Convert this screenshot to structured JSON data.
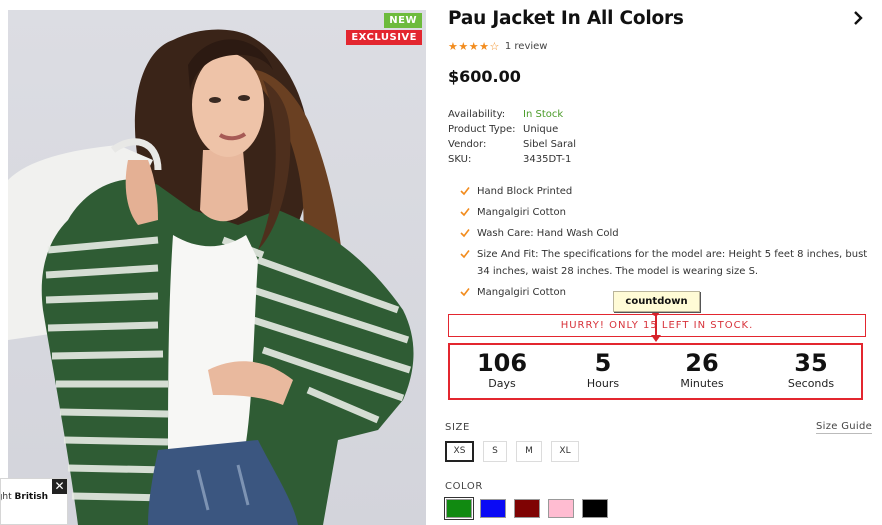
{
  "badges": {
    "new": "NEW",
    "exclusive": "EXCLUSIVE"
  },
  "popup": {
    "text_plain": "ught ",
    "text_bold": "British",
    "close": "✕"
  },
  "product": {
    "title": "Pau Jacket In All Colors",
    "rating": {
      "stars": 4,
      "max": 5,
      "review_count": "1 review"
    },
    "price": "$600.00",
    "meta": [
      {
        "key": "Availability:",
        "value": "In Stock"
      },
      {
        "key": "Product Type:",
        "value": "Unique"
      },
      {
        "key": "Vendor:",
        "value": "Sibel Saral"
      },
      {
        "key": "SKU:",
        "value": "3435DT-1"
      }
    ],
    "features": [
      "Hand Block Printed",
      "Mangalgiri Cotton",
      "Wash Care: Hand Wash Cold",
      "Size And Fit: The specifications for the model are: Height 5 feet 8 inches, bust 34 inches, waist 28 inches. The model is wearing size S.",
      "Mangalgiri Cotton"
    ]
  },
  "stock_message": "HURRY! ONLY 15 LEFT IN STOCK.",
  "annotation_tag": "countdown",
  "countdown": [
    {
      "value": "106",
      "label": "Days"
    },
    {
      "value": "5",
      "label": "Hours"
    },
    {
      "value": "26",
      "label": "Minutes"
    },
    {
      "value": "35",
      "label": "Seconds"
    }
  ],
  "size": {
    "label": "SIZE",
    "guide": "Size Guide",
    "options": [
      "XS",
      "S",
      "M",
      "XL"
    ],
    "selected": "XS"
  },
  "color": {
    "label": "COLOR",
    "options": [
      "#118a11",
      "#0a0af5",
      "#7f0303",
      "#ffbcd1",
      "#000000"
    ],
    "selected": 0
  },
  "theme": {
    "accent_red": "#e3262f",
    "star_orange": "#f28c1e",
    "instock_green": "#4a9b28",
    "badge_green": "#6dbb3c"
  }
}
